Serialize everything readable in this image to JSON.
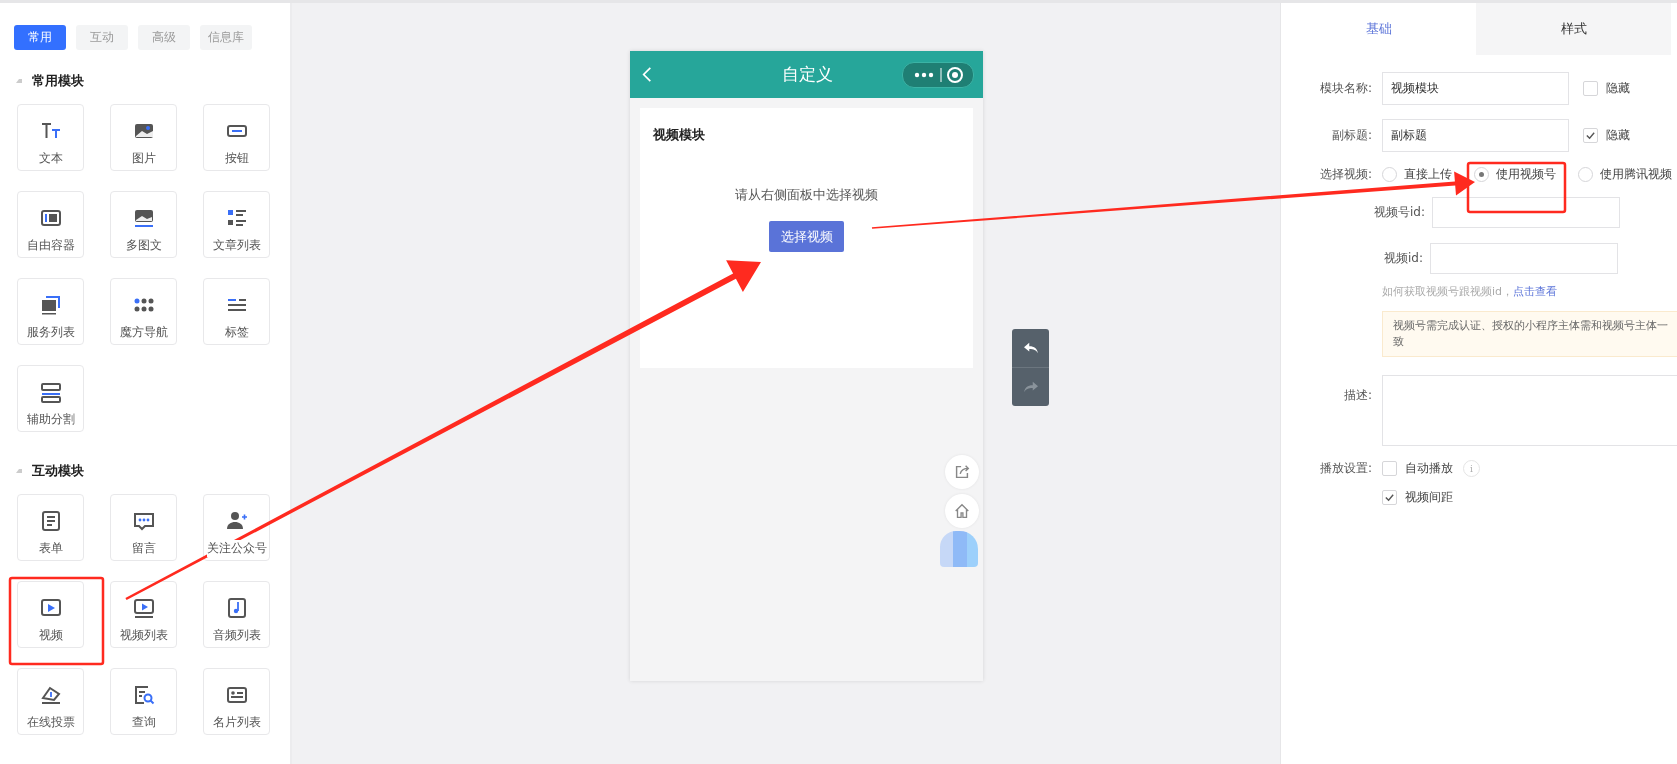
{
  "left_tabs": [
    {
      "label": "常用",
      "selected": true
    },
    {
      "label": "互动",
      "selected": false
    },
    {
      "label": "高级",
      "selected": false
    },
    {
      "label": "信息库",
      "selected": false
    }
  ],
  "module_groups": [
    {
      "title": "常用模块",
      "expanded": true,
      "items": [
        {
          "label": "文本",
          "kind": "text"
        },
        {
          "label": "图片",
          "kind": "image"
        },
        {
          "label": "按钮",
          "kind": "button"
        },
        {
          "label": "自由容器",
          "kind": "container"
        },
        {
          "label": "多图文",
          "kind": "gallery"
        },
        {
          "label": "文章列表",
          "kind": "articles"
        },
        {
          "label": "服务列表",
          "kind": "services"
        },
        {
          "label": "魔方导航",
          "kind": "grid"
        },
        {
          "label": "标签",
          "kind": "tags"
        },
        {
          "label": "辅助分割",
          "kind": "divider"
        }
      ]
    },
    {
      "title": "互动模块",
      "expanded": true,
      "items": [
        {
          "label": "表单",
          "kind": "form"
        },
        {
          "label": "留言",
          "kind": "message"
        },
        {
          "label": "关注公众号",
          "kind": "follow"
        },
        {
          "label": "视频",
          "kind": "video"
        },
        {
          "label": "视频列表",
          "kind": "videolist"
        },
        {
          "label": "音频列表",
          "kind": "audio"
        },
        {
          "label": "在线投票",
          "kind": "vote"
        },
        {
          "label": "查询",
          "kind": "query"
        },
        {
          "label": "名片列表",
          "kind": "card"
        }
      ]
    }
  ],
  "phone": {
    "title": "自定义",
    "module": {
      "title": "视频模块",
      "hint": "请从右侧面板中选择视频",
      "button": "选择视频"
    }
  },
  "right_tabs": [
    {
      "label": "基础",
      "selected": true
    },
    {
      "label": "样式",
      "selected": false
    }
  ],
  "form": {
    "name": {
      "label": "模块名称:",
      "value": "视频模块",
      "hide": {
        "label": "隐藏",
        "checked": false
      }
    },
    "subtitle": {
      "label": "副标题:",
      "value": "副标题",
      "hide": {
        "label": "隐藏",
        "checked": true
      }
    },
    "source": {
      "label": "选择视频:",
      "options": [
        {
          "label": "直接上传",
          "selected": false
        },
        {
          "label": "使用视频号",
          "selected": true
        },
        {
          "label": "使用腾讯视频",
          "selected": false
        }
      ]
    },
    "channel_id": {
      "label": "视频号id:"
    },
    "video_id": {
      "label": "视频id:"
    },
    "help": {
      "text": "如何获取视频号跟视频id，",
      "link": "点击查看"
    },
    "notice": "视频号需完成认证、授权的小程序主体需和视频号主体一致",
    "description": {
      "label": "描述:"
    },
    "playback": {
      "label": "播放设置:",
      "options": [
        {
          "label": "自动播放",
          "checked": false,
          "info": "i"
        },
        {
          "label": "视频间距",
          "checked": true
        }
      ]
    }
  }
}
